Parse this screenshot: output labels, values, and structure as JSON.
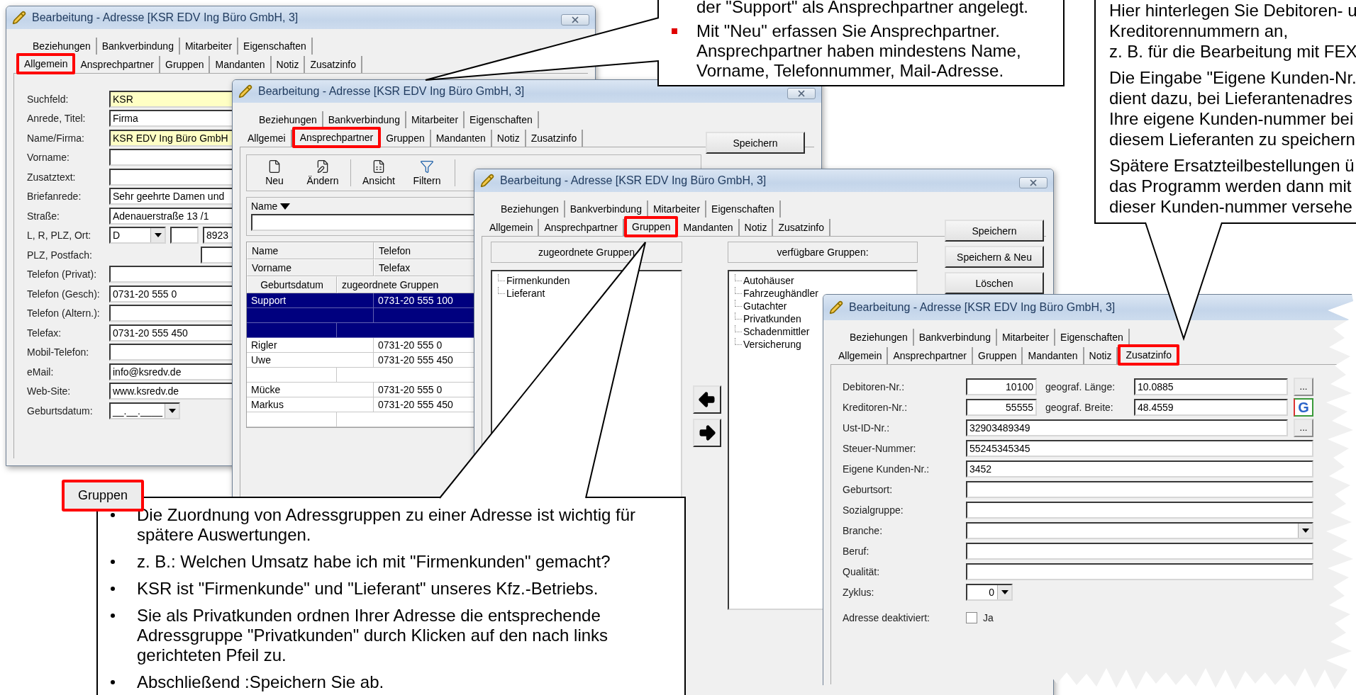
{
  "windows": [
    {
      "kind": "allgemein",
      "title": "Bearbeitung - Adresse [KSR EDV Ing Büro GmbH, 3]",
      "tab_rows": [
        [
          {
            "label": "Beziehungen",
            "selected": false
          },
          {
            "label": "Bankverbindung",
            "selected": false
          },
          {
            "label": "Mitarbeiter",
            "selected": false
          },
          {
            "label": "Eigenschaften",
            "selected": false
          }
        ],
        [
          {
            "label": "Allgemein",
            "selected": true
          },
          {
            "label": "Ansprechpartner",
            "selected": false
          },
          {
            "label": "Gruppen",
            "selected": false
          },
          {
            "label": "Mandanten",
            "selected": false
          },
          {
            "label": "Notiz",
            "selected": false
          },
          {
            "label": "Zusatzinfo",
            "selected": false
          }
        ]
      ],
      "fields": [
        {
          "kind": "text",
          "label": "Suchfeld:",
          "value": "KSR",
          "highlighted": true
        },
        {
          "kind": "text",
          "label": "Anrede, Titel:",
          "value": "Firma",
          "highlighted": false
        },
        {
          "kind": "text",
          "label": "Name/Firma:",
          "value": "KSR EDV Ing Büro GmbH",
          "highlighted": true
        },
        {
          "kind": "text",
          "label": "Vorname:",
          "highlighted": false
        },
        {
          "kind": "text",
          "label": "Zusatztext:",
          "highlighted": false
        },
        {
          "kind": "text",
          "label": "Briefanrede:",
          "value": "Sehr geehrte Damen und",
          "highlighted": false
        },
        {
          "kind": "text",
          "label": "Straße:",
          "value": "Adenauerstraße 13 /1",
          "highlighted": false
        },
        {
          "kind": "location",
          "label": "L, R, PLZ, Ort:",
          "country": "D",
          "zip": "8923"
        },
        {
          "kind": "small",
          "label": "PLZ, Postfach:"
        },
        {
          "kind": "text",
          "label": "Telefon (Privat):",
          "highlighted": false
        },
        {
          "kind": "text",
          "label": "Telefon (Gesch):",
          "value": "0731-20 555 0",
          "highlighted": false
        },
        {
          "kind": "text",
          "label": "Telefon (Altern.):",
          "highlighted": false
        },
        {
          "kind": "text",
          "label": "Telefax:",
          "value": "0731-20 555 450",
          "highlighted": false
        },
        {
          "kind": "text",
          "label": "Mobil-Telefon:",
          "highlighted": false
        },
        {
          "kind": "text",
          "label": "eMail:",
          "value": "info@ksredv.de",
          "highlighted": false
        },
        {
          "kind": "text",
          "label": "Web-Site:",
          "value": "www.ksredv.de",
          "highlighted": false
        },
        {
          "kind": "combo",
          "label": "Geburtsdatum:",
          "value": "__.__.____"
        }
      ]
    },
    {
      "kind": "ansprechpartner",
      "title": "Bearbeitung - Adresse [KSR EDV Ing Büro GmbH, 3]",
      "tab_rows": [
        [
          {
            "label": "Beziehungen",
            "selected": false
          },
          {
            "label": "Bankverbindung",
            "selected": false
          },
          {
            "label": "Mitarbeiter",
            "selected": false
          },
          {
            "label": "Eigenschaften",
            "selected": false
          }
        ],
        [
          {
            "label": "Allgemei",
            "selected": false
          },
          {
            "label": "Ansprechpartner",
            "selected": true
          },
          {
            "label": "Gruppen",
            "selected": false
          },
          {
            "label": "Mandanten",
            "selected": false
          },
          {
            "label": "Notiz",
            "selected": false
          },
          {
            "label": "Zusatzinfo",
            "selected": false
          }
        ]
      ],
      "toolbar": [
        {
          "kind": "new",
          "label": "Neu"
        },
        {
          "kind": "edit",
          "label": "Ändern"
        },
        {
          "kind": "view",
          "label": "Ansicht"
        },
        {
          "kind": "filter",
          "label": "Filtern"
        }
      ],
      "sort": {
        "label": "Name"
      },
      "headers": [
        [
          "Name",
          "Telefon"
        ],
        [
          "Vorname",
          "Telefax"
        ],
        [
          "Geburtsdatum",
          "zugeordnete Gruppen"
        ]
      ],
      "contacts": [
        {
          "name": "Support",
          "phone": "0731-20 555 100",
          "selected": true
        },
        {
          "name": "Rigler",
          "phone": "0731-20 555 0",
          "first_name": "Uwe",
          "fax": "0731-20 555 450",
          "selected": false
        },
        {
          "name": "Mücke",
          "phone": "0731-20 555 0",
          "first_name": "Markus",
          "fax": "0731-20 555 450",
          "selected": false
        }
      ],
      "buttons": [
        "Speichern"
      ]
    },
    {
      "kind": "gruppen",
      "title": "Bearbeitung - Adresse [KSR EDV Ing Büro GmbH, 3]",
      "tab_rows": [
        [
          {
            "label": "Beziehungen",
            "selected": false
          },
          {
            "label": "Bankverbindung",
            "selected": false
          },
          {
            "label": "Mitarbeiter",
            "selected": false
          },
          {
            "label": "Eigenschaften",
            "selected": false
          }
        ],
        [
          {
            "label": "Allgemein",
            "selected": false
          },
          {
            "label": "Ansprechpartner",
            "selected": false
          },
          {
            "label": "Gruppen",
            "selected": true
          },
          {
            "label": "Mandanten",
            "selected": false
          },
          {
            "label": "Notiz",
            "selected": false
          },
          {
            "label": "Zusatzinfo",
            "selected": false
          }
        ]
      ],
      "assigned": {
        "title": "zugeordnete Gruppen",
        "items": [
          "Firmenkunden",
          "Lieferant"
        ]
      },
      "available": {
        "title": "verfügbare Gruppen:",
        "items": [
          "Autohäuser",
          "Fahrzeughändler",
          "Gutachter",
          "Privatkunden",
          "Schadenmittler",
          "Versicherung"
        ]
      },
      "arrows": [
        {
          "kind": "left"
        },
        {
          "kind": "right"
        }
      ],
      "buttons": [
        "Speichern",
        "Speichern & Neu",
        "Löschen"
      ]
    },
    {
      "kind": "zusatzinfo",
      "title": "Bearbeitung - Adresse [KSR EDV Ing Büro GmbH, 3]",
      "tab_rows": [
        [
          {
            "label": "Beziehungen",
            "selected": false
          },
          {
            "label": "Bankverbindung",
            "selected": false
          },
          {
            "label": "Mitarbeiter",
            "selected": false
          },
          {
            "label": "Eigenschaften",
            "selected": false
          }
        ],
        [
          {
            "label": "Allgemein",
            "selected": false
          },
          {
            "label": "Ansprechpartner",
            "selected": false
          },
          {
            "label": "Gruppen",
            "selected": false
          },
          {
            "label": "Mandanten",
            "selected": false
          },
          {
            "label": "Notiz",
            "selected": false
          },
          {
            "label": "Zusatzinfo",
            "selected": true
          }
        ]
      ],
      "rows": [
        {
          "kind": "pair",
          "label": "Debitoren-Nr.:",
          "value": "10100",
          "label2": "geograf. Länge:",
          "value2": "10.0885",
          "button": {
            "kind": "ellipsis",
            "label": "..."
          }
        },
        {
          "kind": "pair",
          "label": "Kreditoren-Nr.:",
          "value": "55555",
          "label2": "geograf. Breite:",
          "value2": "48.4559",
          "button": {
            "kind": "google",
            "label": "G"
          }
        },
        {
          "kind": "text",
          "label": "Ust-ID-Nr.:",
          "value": "32903489349",
          "button": {
            "kind": "ellipsis",
            "label": "..."
          }
        },
        {
          "kind": "text",
          "label": "Steuer-Nummer:",
          "value": "55245345345"
        },
        {
          "kind": "text",
          "label": "Eigene Kunden-Nr.:",
          "value": "3452"
        },
        {
          "kind": "text",
          "label": "Geburtsort:"
        },
        {
          "kind": "text",
          "label": "Sozialgruppe:"
        },
        {
          "kind": "select",
          "label": "Branche:"
        },
        {
          "kind": "text",
          "label": "Beruf:"
        },
        {
          "kind": "text",
          "label": "Qualität:"
        },
        {
          "kind": "spin",
          "label": "Zyklus:",
          "value": "0"
        },
        {
          "kind": "check",
          "label": "Adresse deaktiviert:",
          "option": "Ja",
          "checked": false
        }
      ]
    }
  ],
  "callouts": [
    {
      "kind": "top",
      "items": [
        {
          "bullet": false,
          "text": "der \"Support\" als Ansprechpartner angelegt."
        },
        {
          "bullet": true,
          "text": "Mit \"Neu\" erfassen Sie Ansprechpartner. Ansprechpartner haben mindestens Name, Vorname, Telefonnummer, Mail-Adresse."
        }
      ]
    },
    {
      "kind": "right",
      "paragraphs": [
        [
          "Hier hinterlegen Sie Debitoren- u",
          "Kreditorennummern an,",
          "z. B. für die Bearbeitung mit FEX"
        ],
        [
          "Die Eingabe \"Eigene Kunden-Nr.",
          "dient dazu, bei Lieferantenadres",
          "Ihre eigene Kunden-nummer bei",
          "diesem Lieferanten zu speichern"
        ],
        [
          "Spätere Ersatzteilbestellungen ü",
          "das Programm werden dann mit",
          "dieser Kunden-nummer versehe"
        ]
      ]
    },
    {
      "kind": "bottom",
      "items": [
        {
          "bullet": true,
          "text": "Die Zuordnung von Adressgruppen zu einer Adresse ist wichtig für spätere Auswertungen."
        },
        {
          "bullet": true,
          "text": "z. B.: Welchen Umsatz habe ich mit \"Firmenkunden\" gemacht?"
        },
        {
          "bullet": true,
          "text": "KSR ist \"Firmenkunde\" und \"Lieferant\" unseres Kfz.-Betriebs."
        },
        {
          "bullet": true,
          "text": "Sie als Privatkunden ordnen Ihrer Adresse die entsprechende Adressgruppe \"Privatkunden\" durch Klicken auf den nach links gerichteten Pfeil zu."
        },
        {
          "bullet": true,
          "text": "Abschließend :Speichern Sie ab."
        }
      ]
    }
  ],
  "gruppen_button": {
    "label": "Gruppen"
  }
}
